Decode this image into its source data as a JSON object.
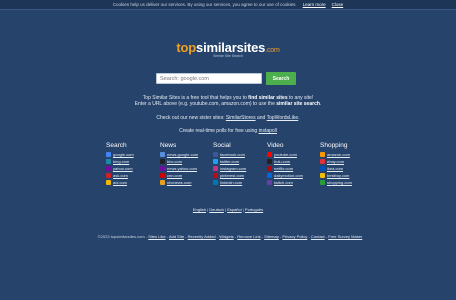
{
  "cookie": {
    "text": "Cookies help us deliver our services. By using our services, you agree to our use of cookies.",
    "learn_more": "Learn more",
    "close": "Close"
  },
  "logo": {
    "top": "top",
    "similar": "similar",
    "sites": "sites",
    "dotcom": ".com"
  },
  "tagline": "Similar Site Search",
  "search": {
    "placeholder": "Search: google.com",
    "button": "Search"
  },
  "intro": {
    "line1_pre": "Top Similar Sites is a free tool that helps you to ",
    "line1_bold": "find similar sites",
    "line1_post": " to any site!",
    "line2_pre": "Enter a URL above (e.g. youtube.com, amazon.com) to use the ",
    "line2_bold": "similar site search",
    "line2_post": "."
  },
  "sister": {
    "pre": "Check out our new sister sites: ",
    "link1": "SimilarStores",
    "and": " and ",
    "link2": "TopWordsLike",
    "post": "."
  },
  "polls": {
    "pre": "Create real-time polls for free using ",
    "link": "instapoll"
  },
  "categories": [
    {
      "title": "Search",
      "items": [
        {
          "label": "google.com",
          "color": "#4285f4"
        },
        {
          "label": "bing.com",
          "color": "#1e88a8"
        },
        {
          "label": "yahoo.com",
          "color": "#720e9e"
        },
        {
          "label": "ask.com",
          "color": "#d21f26"
        },
        {
          "label": "aol.com",
          "color": "#f5b800"
        }
      ]
    },
    {
      "title": "News",
      "items": [
        {
          "label": "news.google.com",
          "color": "#5a8ee0"
        },
        {
          "label": "bbc.com",
          "color": "#222222"
        },
        {
          "label": "news.yahoo.com",
          "color": "#720e9e"
        },
        {
          "label": "cnn.com",
          "color": "#cc0000"
        },
        {
          "label": "nbcnews.com",
          "color": "#e8a020"
        }
      ]
    },
    {
      "title": "Social",
      "items": [
        {
          "label": "facebook.com",
          "color": "#3b5998"
        },
        {
          "label": "twitter.com",
          "color": "#1da1f2"
        },
        {
          "label": "instagram.com",
          "color": "#c13584"
        },
        {
          "label": "pinterest.com",
          "color": "#bd081c"
        },
        {
          "label": "linkedin.com",
          "color": "#0077b5"
        }
      ]
    },
    {
      "title": "Video",
      "items": [
        {
          "label": "youtube.com",
          "color": "#ff0000"
        },
        {
          "label": "hulu.com",
          "color": "#222222"
        },
        {
          "label": "netflix.com",
          "color": "#b00710"
        },
        {
          "label": "dailymotion.com",
          "color": "#0066dc"
        },
        {
          "label": "twitch.com",
          "color": "#6441a5"
        }
      ]
    },
    {
      "title": "Shopping",
      "items": [
        {
          "label": "amazon.com",
          "color": "#ff9900"
        },
        {
          "label": "ebay.com",
          "color": "#e53238"
        },
        {
          "label": "ikea.com",
          "color": "#0051ba"
        },
        {
          "label": "bestbuy.com",
          "color": "#f0c000"
        },
        {
          "label": "shopping.com",
          "color": "#2a9d3a"
        }
      ]
    }
  ],
  "langs": [
    "English",
    "Deutsch",
    "Español",
    "Português"
  ],
  "footer": {
    "copyright": "©2023 topsimilarsites.com",
    "links": [
      "Sites Like",
      "Add Site",
      "Recently Added",
      "Widgets",
      "Remove Link",
      "Sitemap",
      "Privacy Policy",
      "Contact",
      "Free Survey Maker"
    ]
  }
}
